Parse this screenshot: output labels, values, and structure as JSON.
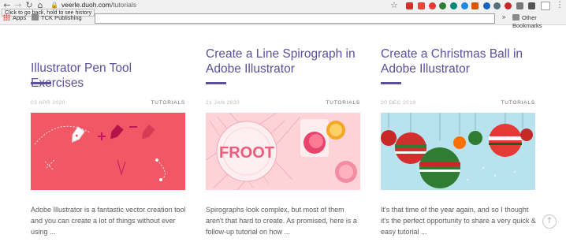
{
  "browser": {
    "url_host": "veerle.duoh.com",
    "url_path": "/tutorials",
    "tooltip": "Click to go back, hold to see history",
    "bookmarks": {
      "apps": "Apps",
      "tck": "TCK Publishing",
      "other": "Other Bookmarks",
      "overflow": "»"
    }
  },
  "cards": [
    {
      "title": "Illustrator Pen Tool Exercises",
      "date": "03 APR 2020",
      "category": "TUTORIALS",
      "excerpt": "Adobe Illustrator is a fantastic vector creation tool and you can create a lot of things without ever using ..."
    },
    {
      "title": "Create a Line Spirograph in Adobe Illustrator",
      "date": "21 JAN 2020",
      "category": "TUTORIALS",
      "excerpt": "Spirographs look complex, but most of them aren't that hard to create. As promised, here is a follow-up tutorial on how ...",
      "thumb_word": "FROOT"
    },
    {
      "title": "Create a Christmas Ball in Adobe Illustrator",
      "date": "20 DEC 2019",
      "category": "TUTORIALS",
      "excerpt": "It's that time of the year again, and so I thought it's the perfect opportunity to share a very quick & easy tutorial ..."
    }
  ],
  "colors": {
    "accent": "#5b4e9b",
    "pen_bg": "#f25766",
    "spiro_bg": "#fdd3d8",
    "xmas_bg": "#b9e2ef"
  },
  "icons": [
    "back-arrow-icon",
    "forward-arrow-icon",
    "reload-icon",
    "home-icon",
    "lock-icon",
    "star-icon",
    "scroll-to-top-icon"
  ]
}
